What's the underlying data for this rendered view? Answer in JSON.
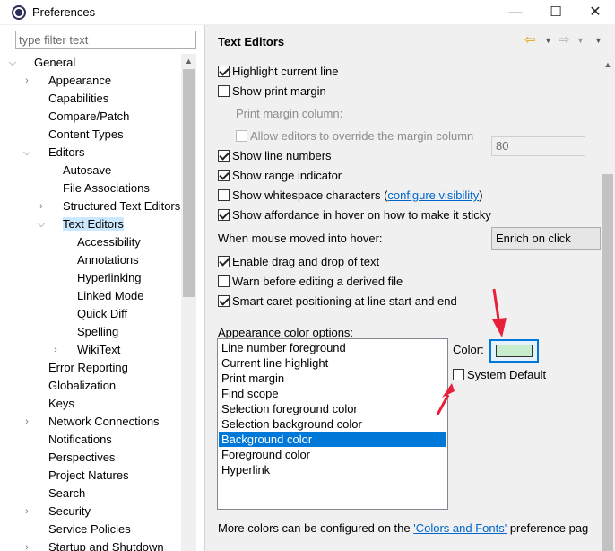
{
  "window": {
    "title": "Preferences",
    "minimize": "—",
    "maximize": "☐",
    "close": "✕"
  },
  "filter": {
    "placeholder": "type filter text"
  },
  "tree": [
    {
      "label": "General",
      "indent": 0,
      "toggle": "expanded"
    },
    {
      "label": "Appearance",
      "indent": 1,
      "toggle": "collapsed"
    },
    {
      "label": "Capabilities",
      "indent": 1,
      "toggle": "none"
    },
    {
      "label": "Compare/Patch",
      "indent": 1,
      "toggle": "none"
    },
    {
      "label": "Content Types",
      "indent": 1,
      "toggle": "none"
    },
    {
      "label": "Editors",
      "indent": 1,
      "toggle": "expanded"
    },
    {
      "label": "Autosave",
      "indent": 2,
      "toggle": "none"
    },
    {
      "label": "File Associations",
      "indent": 2,
      "toggle": "none"
    },
    {
      "label": "Structured Text Editors",
      "indent": 2,
      "toggle": "collapsed"
    },
    {
      "label": "Text Editors",
      "indent": 2,
      "toggle": "expanded",
      "selected": true
    },
    {
      "label": "Accessibility",
      "indent": 3,
      "toggle": "none"
    },
    {
      "label": "Annotations",
      "indent": 3,
      "toggle": "none"
    },
    {
      "label": "Hyperlinking",
      "indent": 3,
      "toggle": "none"
    },
    {
      "label": "Linked Mode",
      "indent": 3,
      "toggle": "none"
    },
    {
      "label": "Quick Diff",
      "indent": 3,
      "toggle": "none"
    },
    {
      "label": "Spelling",
      "indent": 3,
      "toggle": "none"
    },
    {
      "label": "WikiText",
      "indent": 3,
      "toggle": "collapsed"
    },
    {
      "label": "Error Reporting",
      "indent": 1,
      "toggle": "none"
    },
    {
      "label": "Globalization",
      "indent": 1,
      "toggle": "none"
    },
    {
      "label": "Keys",
      "indent": 1,
      "toggle": "none"
    },
    {
      "label": "Network Connections",
      "indent": 1,
      "toggle": "collapsed"
    },
    {
      "label": "Notifications",
      "indent": 1,
      "toggle": "none"
    },
    {
      "label": "Perspectives",
      "indent": 1,
      "toggle": "none"
    },
    {
      "label": "Project Natures",
      "indent": 1,
      "toggle": "none"
    },
    {
      "label": "Search",
      "indent": 1,
      "toggle": "none"
    },
    {
      "label": "Security",
      "indent": 1,
      "toggle": "collapsed"
    },
    {
      "label": "Service Policies",
      "indent": 1,
      "toggle": "none"
    },
    {
      "label": "Startup and Shutdown",
      "indent": 1,
      "toggle": "collapsed"
    }
  ],
  "page": {
    "title": "Text Editors",
    "options": {
      "highlight_current_line": {
        "label": "Highlight current line",
        "checked": true
      },
      "show_print_margin": {
        "label": "Show print margin",
        "checked": false
      },
      "print_margin_column": {
        "label": "Print margin column:",
        "value": "80"
      },
      "allow_override_margin": {
        "label": "Allow editors to override the margin column",
        "checked": false
      },
      "show_line_numbers": {
        "label": "Show line numbers",
        "checked": true
      },
      "show_range_indicator": {
        "label": "Show range indicator",
        "checked": true
      },
      "show_whitespace": {
        "label": "Show whitespace characters (",
        "link": "configure visibility",
        "suffix": ")",
        "checked": false
      },
      "show_affordance": {
        "label": "Show affordance in hover on how to make it sticky",
        "checked": true
      },
      "hover_mouse": {
        "label": "When mouse moved into hover:",
        "value": "Enrich on click"
      },
      "drag_drop": {
        "label": "Enable drag and drop of text",
        "checked": true
      },
      "warn_derived": {
        "label": "Warn before editing a derived file",
        "checked": false
      },
      "smart_caret": {
        "label": "Smart caret positioning at line start and end",
        "checked": true
      }
    },
    "appearance": {
      "heading": "Appearance color options:",
      "items": [
        "Line number foreground",
        "Current line highlight",
        "Print margin",
        "Find scope",
        "Selection foreground color",
        "Selection background color",
        "Background color",
        "Foreground color",
        "Hyperlink"
      ],
      "selected_index": 6,
      "color_label": "Color:",
      "color_value": "#c7edcc",
      "system_default": {
        "label": "System Default",
        "checked": false
      }
    },
    "footer": {
      "prefix": "More colors can be configured on the ",
      "link": "'Colors and Fonts'",
      "suffix": " preference pag"
    }
  },
  "colors": {
    "selection": "#0078d7",
    "tree_selection": "#cce8ff",
    "link": "#0066cc",
    "annotation_arrow": "#e8203a"
  }
}
